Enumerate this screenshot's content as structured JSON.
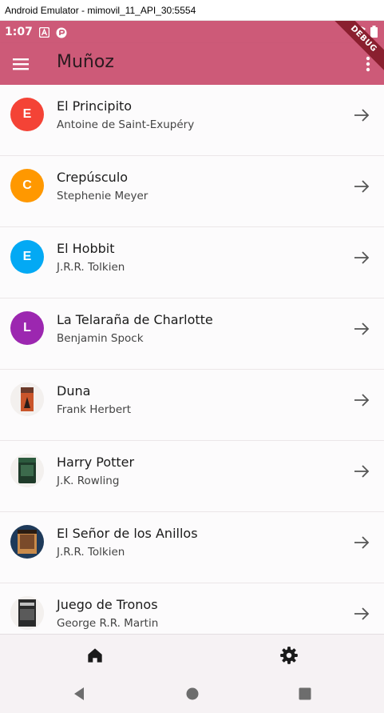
{
  "window": {
    "title": "Android Emulator - mimovil_11_API_30:5554"
  },
  "status_bar": {
    "time": "1:07",
    "left_icons": [
      "a-notification-icon",
      "app-notification-icon"
    ],
    "right_icons": [
      "wifi-icon",
      "battery-icon"
    ]
  },
  "app_bar": {
    "title": "Muñoz",
    "debug_banner": "DEBUG"
  },
  "colors": {
    "primary": "#cd5a78",
    "avatar_red": "#f44336",
    "avatar_orange": "#ff9800",
    "avatar_blue": "#03a9f4",
    "avatar_purple": "#9c27b0"
  },
  "books": [
    {
      "title": "El Principito",
      "author": "Antoine de Saint-Exupéry",
      "avatar_letter": "E",
      "avatar_color": "#f44336"
    },
    {
      "title": "Crepúsculo",
      "author": "Stephenie Meyer",
      "avatar_letter": "C",
      "avatar_color": "#ff9800"
    },
    {
      "title": "El Hobbit",
      "author": "J.R.R. Tolkien",
      "avatar_letter": "E",
      "avatar_color": "#03a9f4"
    },
    {
      "title": "La Telaraña de Charlotte",
      "author": "Benjamin Spock",
      "avatar_letter": "L",
      "avatar_color": "#9c27b0"
    },
    {
      "title": "Duna",
      "author": "Frank Herbert",
      "avatar_letter": "",
      "avatar_image": "dune-cover"
    },
    {
      "title": "Harry Potter",
      "author": "J.K. Rowling",
      "avatar_letter": "",
      "avatar_image": "harry-potter-cover"
    },
    {
      "title": "El Señor de los Anillos",
      "author": "J.R.R. Tolkien",
      "avatar_letter": "",
      "avatar_image": "lotr-cover"
    },
    {
      "title": "Juego de Tronos",
      "author": "George R.R. Martin",
      "avatar_letter": "",
      "avatar_image": "got-cover"
    }
  ],
  "bottom_nav": {
    "items": [
      "home-icon",
      "settings-icon"
    ]
  },
  "system_nav": {
    "buttons": [
      "back-icon",
      "home-circle-icon",
      "recents-icon"
    ]
  }
}
